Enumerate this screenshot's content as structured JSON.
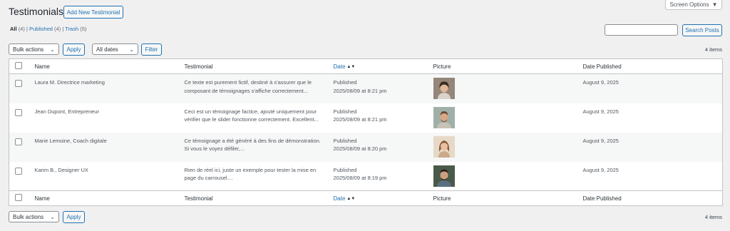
{
  "header": {
    "title": "Testimonials",
    "add_new": "Add New Testimonial",
    "screen_options": "Screen Options"
  },
  "views": {
    "all": "All",
    "all_count": "(4)",
    "published": "Published",
    "published_count": "(4)",
    "trash": "Trash",
    "trash_count": "(5)",
    "sep": "|"
  },
  "search": {
    "button": "Search Posts",
    "value": ""
  },
  "top_nav": {
    "bulk_actions": "Bulk actions",
    "apply": "Apply",
    "dates": "All dates",
    "filter": "Filter",
    "items": "4 items"
  },
  "bottom_nav": {
    "bulk_actions": "Bulk actions",
    "apply": "Apply",
    "items": "4 items"
  },
  "columns": {
    "name": "Name",
    "testimonial": "Testimonial",
    "date": "Date",
    "picture": "Picture",
    "date_published": "Date Published"
  },
  "rows": [
    {
      "name": "Laura M. Directrice marketing",
      "text1": "Ce texte est purement fictif, destiné à s'assurer que le",
      "text2": "composant de témoignages s'affiche correctement...",
      "status": "Published",
      "date": "2025/08/09 at 8:21 pm",
      "published": "August 9, 2025"
    },
    {
      "name": "Jean Dupont, Entrepreneur",
      "text1": "Ceci est un témoignage factice, ajouté uniquement pour",
      "text2": "vérifier que le slider fonctionne correctement. Excellent...",
      "status": "Published",
      "date": "2025/08/09 at 8:21 pm",
      "published": "August 9, 2025"
    },
    {
      "name": "Marie Lemoine, Coach digitale",
      "text1": "Ce témoignage a été généré à des fins de démonstration.",
      "text2": "Si vous le voyez défiler,...",
      "status": "Published",
      "date": "2025/08/09 at 8:20 pm",
      "published": "August 9, 2025"
    },
    {
      "name": "Karim B., Designer UX",
      "text1": "Rien de réel ici, juste un exemple pour tester la mise en",
      "text2": "page du carrousel....",
      "status": "Published",
      "date": "2025/08/09 at 8:19 pm",
      "published": "August 9, 2025"
    }
  ]
}
